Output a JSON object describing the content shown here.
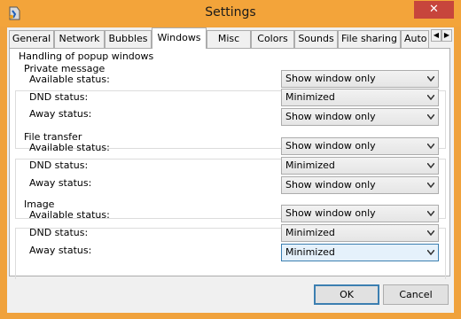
{
  "window": {
    "title": "Settings",
    "close_glyph": "✕"
  },
  "tabs": [
    {
      "label": "General"
    },
    {
      "label": "Network"
    },
    {
      "label": "Bubbles"
    },
    {
      "label": "Windows"
    },
    {
      "label": "Misc"
    },
    {
      "label": "Colors"
    },
    {
      "label": "Sounds"
    },
    {
      "label": "File sharing"
    },
    {
      "label": "Auto"
    }
  ],
  "tab_scroll": {
    "left": "◀",
    "right": "▶"
  },
  "panel": {
    "title": "Handling of popup windows",
    "groups": [
      {
        "title": "Private message",
        "rows": [
          {
            "label": "Available status:",
            "value": "Show window only"
          },
          {
            "label": "DND status:",
            "value": "Minimized"
          },
          {
            "label": "Away status:",
            "value": "Show window only"
          }
        ]
      },
      {
        "title": "File transfer",
        "rows": [
          {
            "label": "Available status:",
            "value": "Show window only"
          },
          {
            "label": "DND status:",
            "value": "Minimized"
          },
          {
            "label": "Away status:",
            "value": "Show window only"
          }
        ]
      },
      {
        "title": "Image",
        "rows": [
          {
            "label": "Available status:",
            "value": "Show window only"
          },
          {
            "label": "DND status:",
            "value": "Minimized"
          },
          {
            "label": "Away status:",
            "value": "Minimized"
          }
        ]
      }
    ]
  },
  "buttons": {
    "ok": "OK",
    "cancel": "Cancel"
  },
  "colors": {
    "titlebar": "#f3a43a",
    "close": "#c7453c",
    "focus_border": "#3c7fb1"
  }
}
